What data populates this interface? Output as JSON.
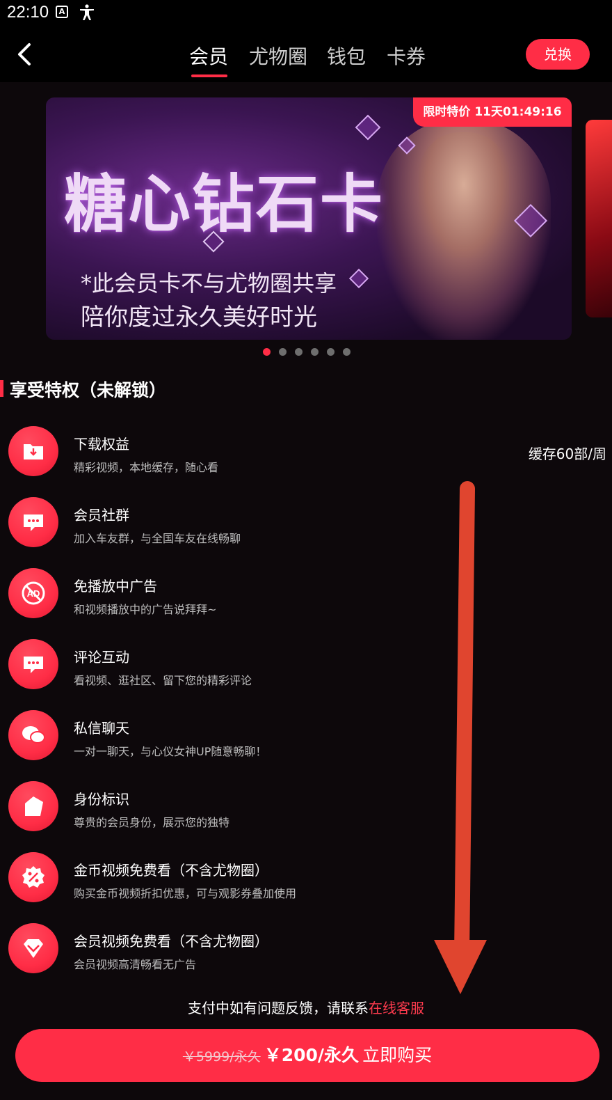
{
  "status": {
    "time": "22:10"
  },
  "tabs": [
    {
      "label": "会员",
      "active": true
    },
    {
      "label": "尤物圈",
      "active": false
    },
    {
      "label": "钱包",
      "active": false
    },
    {
      "label": "卡券",
      "active": false
    }
  ],
  "redeem_label": "兑换",
  "banner": {
    "promo": "限时特价 11天01:49:16",
    "title": "糖心钻石卡",
    "line1": "*此会员卡不与尤物圈共享",
    "line2": "陪你度过永久美好时光",
    "active_index": 0,
    "count": 6
  },
  "section_title": "享受特权（未解锁）",
  "privileges": [
    {
      "title": "下载权益",
      "desc": "精彩视频，本地缓存，随心看",
      "extra": "缓存60部/周",
      "icon": "download-folder-icon"
    },
    {
      "title": "会员社群",
      "desc": "加入车友群，与全国车友在线畅聊",
      "icon": "chat-bubble-icon"
    },
    {
      "title": "免播放中广告",
      "desc": "和视频播放中的广告说拜拜~",
      "icon": "no-ad-icon"
    },
    {
      "title": "评论互动",
      "desc": "看视频、逛社区、留下您的精彩评论",
      "icon": "comment-icon"
    },
    {
      "title": "私信聊天",
      "desc": "一对一聊天，与心仪女神UP随意畅聊！",
      "icon": "messages-icon"
    },
    {
      "title": "身份标识",
      "desc": "尊贵的会员身份，展示您的独特",
      "icon": "badge-icon"
    },
    {
      "title": "金币视频免费看（不含尤物圈）",
      "desc": "购买金币视频折扣优惠，可与观影券叠加使用",
      "icon": "discount-icon"
    },
    {
      "title": "会员视频免费看（不含尤物圈）",
      "desc": "会员视频高清畅看无广告",
      "icon": "diamond-icon"
    }
  ],
  "help": {
    "text": "支付中如有问题反馈，请联系",
    "link": "在线客服"
  },
  "buy": {
    "old_price": "￥5999/永久",
    "new_price": "￥200/永久",
    "label": "立即购买"
  },
  "colors": {
    "accent": "#ff2d46",
    "background": "#0d080b"
  }
}
